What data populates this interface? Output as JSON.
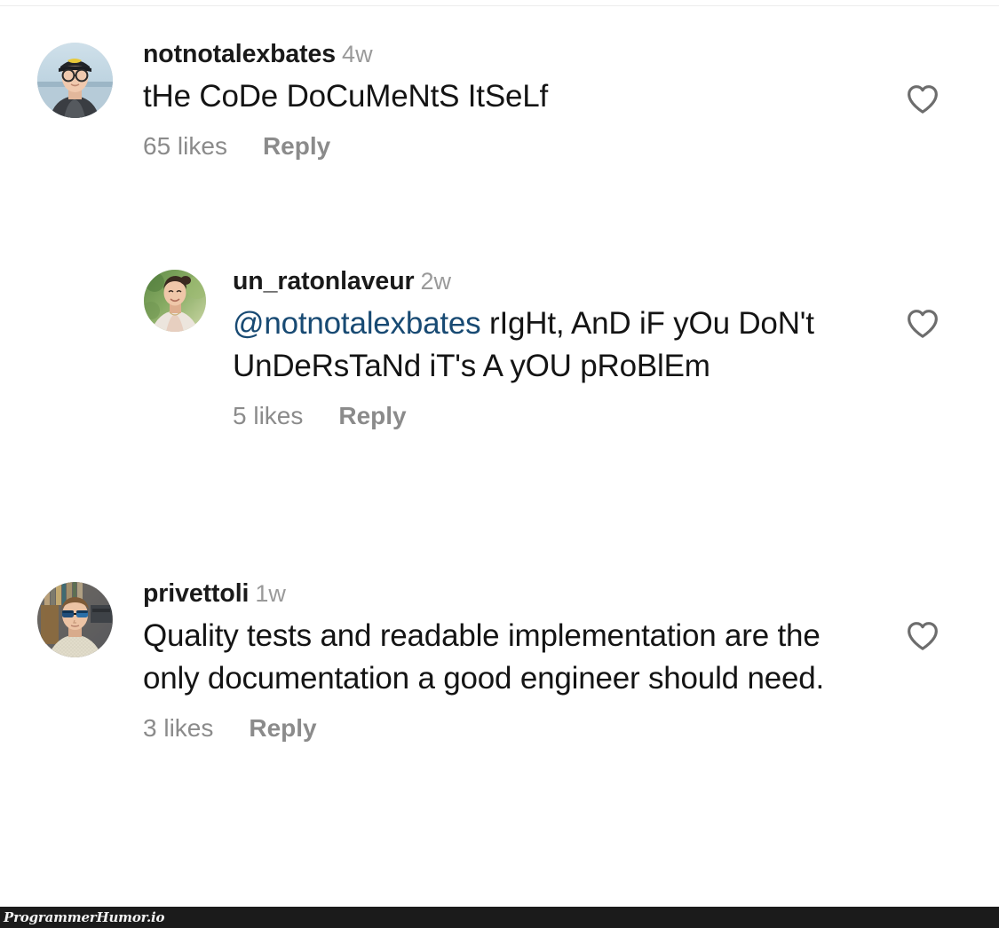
{
  "app": {
    "platform": "instagram-comments",
    "background_color": "#ffffff",
    "text_color": "#141414",
    "muted_color": "#8e8e8e",
    "mention_color": "#184a73"
  },
  "comments": [
    {
      "username": "notnotalexbates",
      "timestamp": "4w",
      "text": "tHe CoDe DoCuMeNtS ItSeLf",
      "mention": "",
      "likes_label": "65 likes",
      "reply_label": "Reply",
      "like_icon": "heart-outline-icon",
      "avatar_name": "avatar-notnotalexbates",
      "level": 0
    },
    {
      "username": "un_ratonlaveur",
      "timestamp": "2w",
      "mention": "@notnotalexbates",
      "text": " rIgHt, AnD iF yOu DoN't UnDeRsTaNd iT's A yOU pRoBlEm",
      "likes_label": "5 likes",
      "reply_label": "Reply",
      "like_icon": "heart-outline-icon",
      "avatar_name": "avatar-un-ratonlaveur",
      "level": 1
    },
    {
      "username": "privettoli",
      "timestamp": "1w",
      "mention": "",
      "text": "Quality tests and readable implementation are the only documentation a good engineer should need.",
      "likes_label": "3 likes",
      "reply_label": "Reply",
      "like_icon": "heart-outline-icon",
      "avatar_name": "avatar-privettoli",
      "level": 0
    }
  ],
  "watermark": {
    "label": "ProgrammerHumor.io",
    "bar_color": "#1b1b1b",
    "text_color": "#f2f2f2"
  }
}
